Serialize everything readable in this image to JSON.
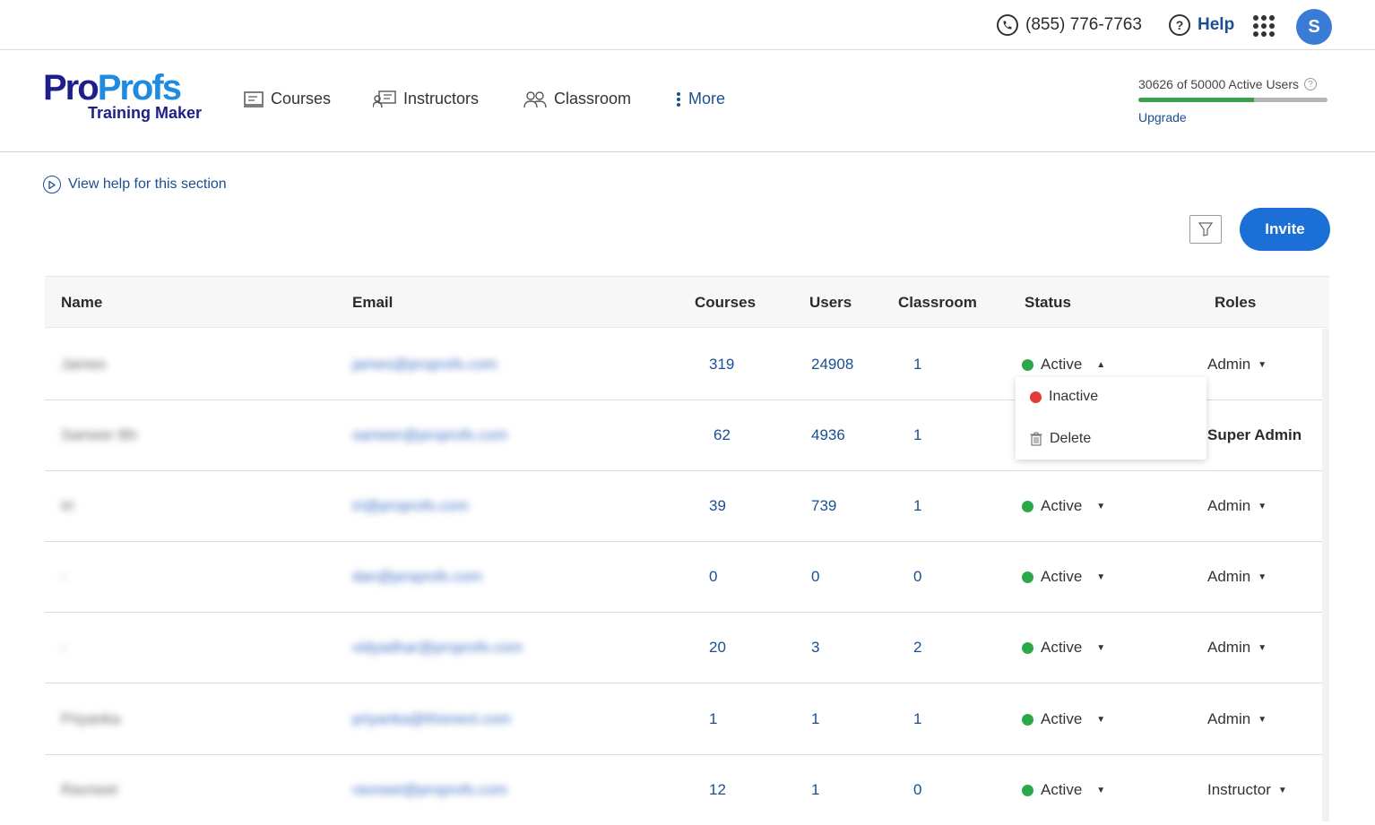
{
  "topbar": {
    "phone": "(855) 776-7763",
    "help_label": "Help",
    "avatar_letter": "S",
    "icons": [
      "phone-icon",
      "help-icon",
      "apps-grid-icon"
    ]
  },
  "logo": {
    "part1": "Pro",
    "part2": "Profs",
    "sub": "Training Maker"
  },
  "nav": {
    "courses": "Courses",
    "instructors": "Instructors",
    "classroom": "Classroom",
    "more": "More"
  },
  "usage": {
    "text": "30626 of 50000 Active Users",
    "used": 30626,
    "total": 50000,
    "upgrade": "Upgrade"
  },
  "help_link": "View help for this section",
  "actions": {
    "invite": "Invite"
  },
  "table": {
    "headers": {
      "name": "Name",
      "email": "Email",
      "courses": "Courses",
      "users": "Users",
      "classroom": "Classroom",
      "status": "Status",
      "roles": "Roles"
    },
    "rows": [
      {
        "name": "James",
        "email": "james@proprofs.com",
        "courses": "319",
        "users": "24908",
        "classroom": "1",
        "status": "Active",
        "role": "Admin"
      },
      {
        "name": "Sameer Bh",
        "email": "sameer@proprofs.com",
        "courses": "62",
        "users": "4936",
        "classroom": "1",
        "status": "",
        "role": "Super Admin"
      },
      {
        "name": "Iri",
        "email": "iri@proprofs.com",
        "courses": "39",
        "users": "739",
        "classroom": "1",
        "status": "Active",
        "role": "Admin"
      },
      {
        "name": "-",
        "email": "dan@proprofs.com",
        "courses": "0",
        "users": "0",
        "classroom": "0",
        "status": "Active",
        "role": "Admin"
      },
      {
        "name": "-",
        "email": "vidyadhar@proprofs.com",
        "courses": "20",
        "users": "3",
        "classroom": "2",
        "status": "Active",
        "role": "Admin"
      },
      {
        "name": "Priyanka",
        "email": "priyanka@thisnext.com",
        "courses": "1",
        "users": "1",
        "classroom": "1",
        "status": "Active",
        "role": "Admin"
      },
      {
        "name": "Ravneet",
        "email": "ravneet@proprofs.com",
        "courses": "12",
        "users": "1",
        "classroom": "0",
        "status": "Active",
        "role": "Instructor"
      }
    ]
  },
  "status_dropdown": {
    "inactive": "Inactive",
    "delete": "Delete"
  },
  "colors": {
    "accent": "#1b6fd6",
    "active": "#2ca84a",
    "inactive": "#e53935",
    "link": "#1a4f91"
  }
}
